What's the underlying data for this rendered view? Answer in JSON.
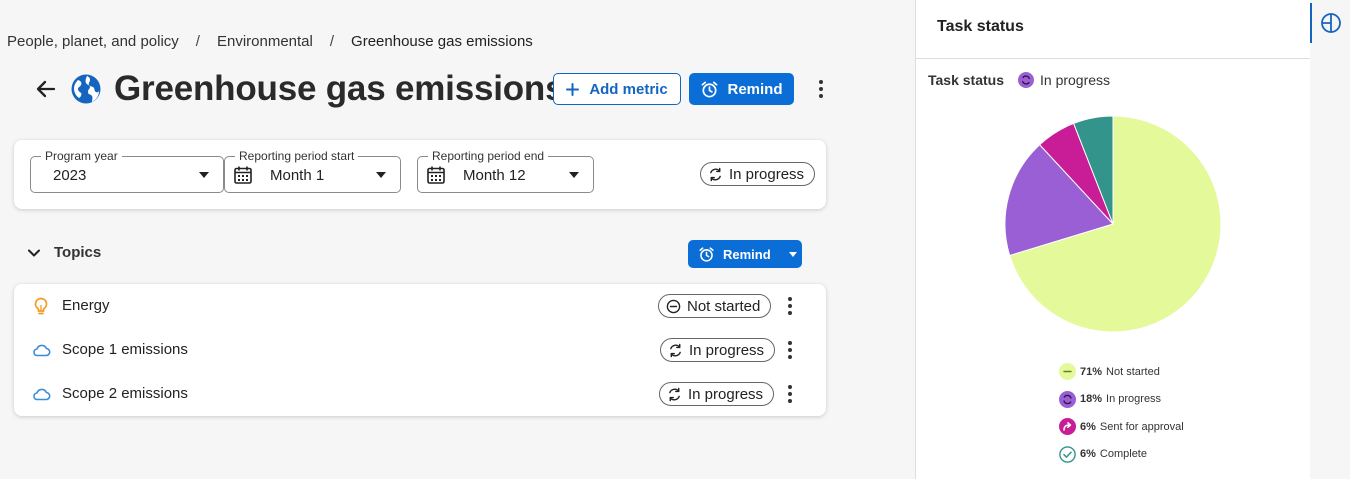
{
  "breadcrumb": {
    "items": [
      "People, planet, and policy",
      "Environmental",
      "Greenhouse gas emissions"
    ],
    "separator": "/"
  },
  "header": {
    "title": "Greenhouse gas emissions",
    "add_metric_label": "Add metric",
    "remind_label": "Remind",
    "back_icon": "arrow-left-icon",
    "globe_icon": "globe-icon"
  },
  "filters": {
    "program_year": {
      "label": "Program year",
      "value": "2023"
    },
    "period_start": {
      "label": "Reporting period start",
      "value": "Month 1"
    },
    "period_end": {
      "label": "Reporting period end",
      "value": "Month 12"
    },
    "status": "In progress"
  },
  "topics": {
    "title": "Topics",
    "remind_label": "Remind",
    "items": [
      {
        "name": "Energy",
        "status": "Not started",
        "icon": "lightbulb-icon"
      },
      {
        "name": "Scope 1 emissions",
        "status": "In progress",
        "icon": "cloud-icon"
      },
      {
        "name": "Scope 2 emissions",
        "status": "In progress",
        "icon": "cloud-icon"
      }
    ]
  },
  "task_panel": {
    "title": "Task status",
    "status_label": "Task status",
    "status_value": "In progress"
  },
  "colors": {
    "accent": "#0b6ed6",
    "not_started": "#e4f99a",
    "in_progress": "#9a5fd4",
    "sent_for_approval": "#c81d97",
    "complete": "#32948a"
  },
  "chart_data": {
    "type": "pie",
    "series": [
      {
        "label": "Not started",
        "percent_text": "71%",
        "value": 71,
        "color": "#e4f99a"
      },
      {
        "label": "In progress",
        "percent_text": "18%",
        "value": 18,
        "color": "#9a5fd4"
      },
      {
        "label": "Sent for approval",
        "percent_text": "6%",
        "value": 6,
        "color": "#c81d97"
      },
      {
        "label": "Complete",
        "percent_text": "6%",
        "value": 6,
        "color": "#32948a"
      }
    ],
    "legend_position": "bottom"
  }
}
